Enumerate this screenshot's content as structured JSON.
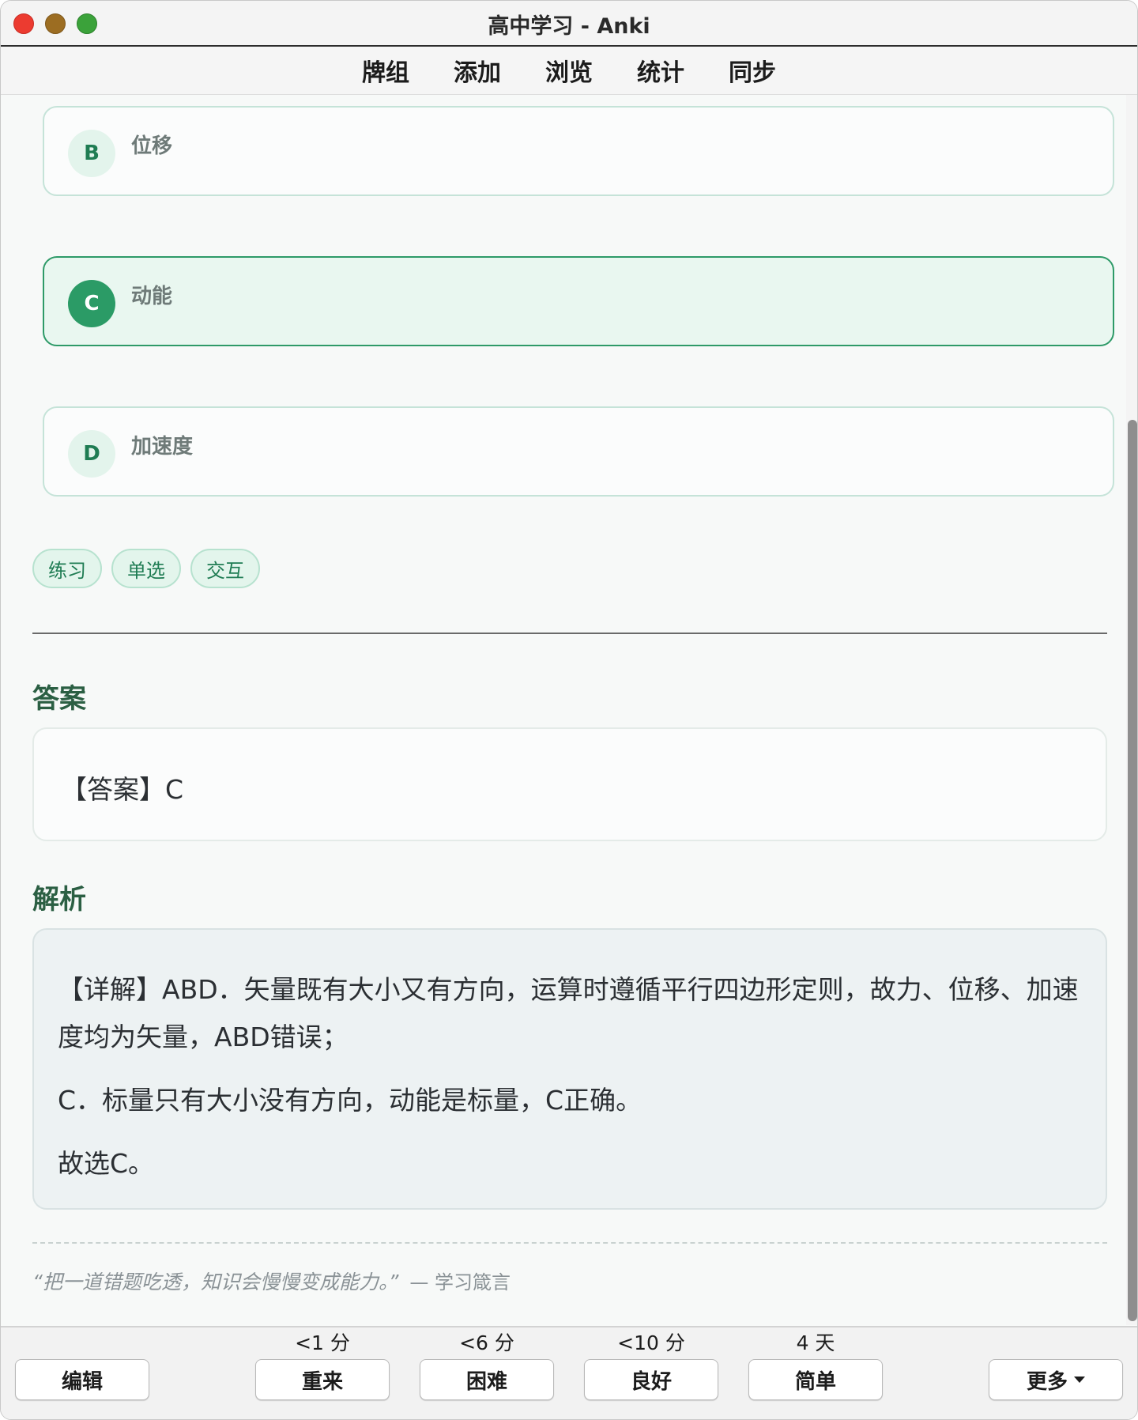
{
  "window": {
    "title": "高中学习 - Anki"
  },
  "toolbar": {
    "items": [
      "牌组",
      "添加",
      "浏览",
      "统计",
      "同步"
    ]
  },
  "options": [
    {
      "letter": "B",
      "text": "位移",
      "selected": false
    },
    {
      "letter": "C",
      "text": "动能",
      "selected": true
    },
    {
      "letter": "D",
      "text": "加速度",
      "selected": false
    }
  ],
  "tags": [
    "练习",
    "单选",
    "交互"
  ],
  "answer": {
    "heading": "答案",
    "text": "【答案】C"
  },
  "explanation": {
    "heading": "解析",
    "paragraphs": [
      "【详解】ABD．矢量既有大小又有方向，运算时遵循平行四边形定则，故力、位移、加速度均为矢量，ABD错误；",
      "C．标量只有大小没有方向，动能是标量，C正确。",
      "故选C。"
    ]
  },
  "quote": {
    "text": "“把一道错题吃透，知识会慢慢变成能力。”",
    "source": "— 学习箴言"
  },
  "bottom": {
    "edit_label": "编辑",
    "more_label": "更多",
    "answers": [
      {
        "label": "重来",
        "interval": "<1 分"
      },
      {
        "label": "困难",
        "interval": "<6 分"
      },
      {
        "label": "良好",
        "interval": "<10 分"
      },
      {
        "label": "简单",
        "interval": "4 天"
      }
    ]
  },
  "colors": {
    "accent": "#2b9b66",
    "heading": "#2b5f43",
    "tag_bg": "#e3f5ec"
  }
}
